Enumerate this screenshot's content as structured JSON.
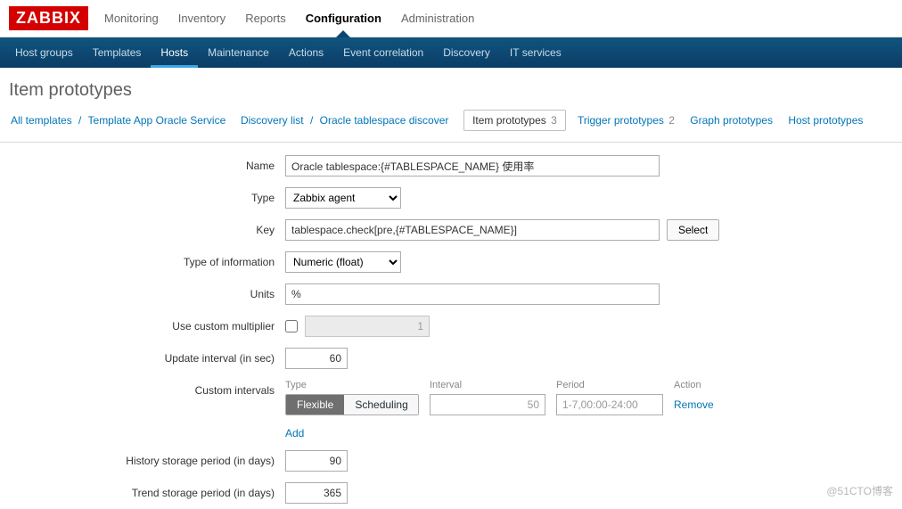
{
  "logo": "ZABBIX",
  "mainnav": {
    "items": [
      {
        "label": "Monitoring"
      },
      {
        "label": "Inventory"
      },
      {
        "label": "Reports"
      },
      {
        "label": "Configuration",
        "active": true
      },
      {
        "label": "Administration"
      }
    ]
  },
  "subnav": {
    "items": [
      {
        "label": "Host groups"
      },
      {
        "label": "Templates"
      },
      {
        "label": "Hosts",
        "active": true
      },
      {
        "label": "Maintenance"
      },
      {
        "label": "Actions"
      },
      {
        "label": "Event correlation"
      },
      {
        "label": "Discovery"
      },
      {
        "label": "IT services"
      }
    ]
  },
  "page_title": "Item prototypes",
  "breadcrumbs": {
    "all_templates": "All templates",
    "template_name": "Template App Oracle Service",
    "discovery_list": "Discovery list",
    "rule_name": "Oracle tablespace discover",
    "tabs": [
      {
        "label": "Item prototypes",
        "count": "3",
        "current": true
      },
      {
        "label": "Trigger prototypes",
        "count": "2"
      },
      {
        "label": "Graph prototypes"
      },
      {
        "label": "Host prototypes"
      }
    ]
  },
  "form": {
    "name_label": "Name",
    "name_value": "Oracle tablespace:{#TABLESPACE_NAME} 使用率",
    "type_label": "Type",
    "type_value": "Zabbix agent",
    "key_label": "Key",
    "key_value": "tablespace.check[pre,{#TABLESPACE_NAME}]",
    "select_button": "Select",
    "info_label": "Type of information",
    "info_value": "Numeric (float)",
    "units_label": "Units",
    "units_value": "%",
    "multiplier_label": "Use custom multiplier",
    "multiplier_value": "1",
    "update_label": "Update interval (in sec)",
    "update_value": "60",
    "custom_label": "Custom intervals",
    "custom": {
      "head_type": "Type",
      "head_interval": "Interval",
      "head_period": "Period",
      "head_action": "Action",
      "flexible": "Flexible",
      "scheduling": "Scheduling",
      "interval_value": "50",
      "period_value": "1-7,00:00-24:00",
      "remove": "Remove",
      "add": "Add"
    },
    "history_label": "History storage period (in days)",
    "history_value": "90",
    "trend_label": "Trend storage period (in days)",
    "trend_value": "365"
  },
  "watermark": "@51CTO博客"
}
